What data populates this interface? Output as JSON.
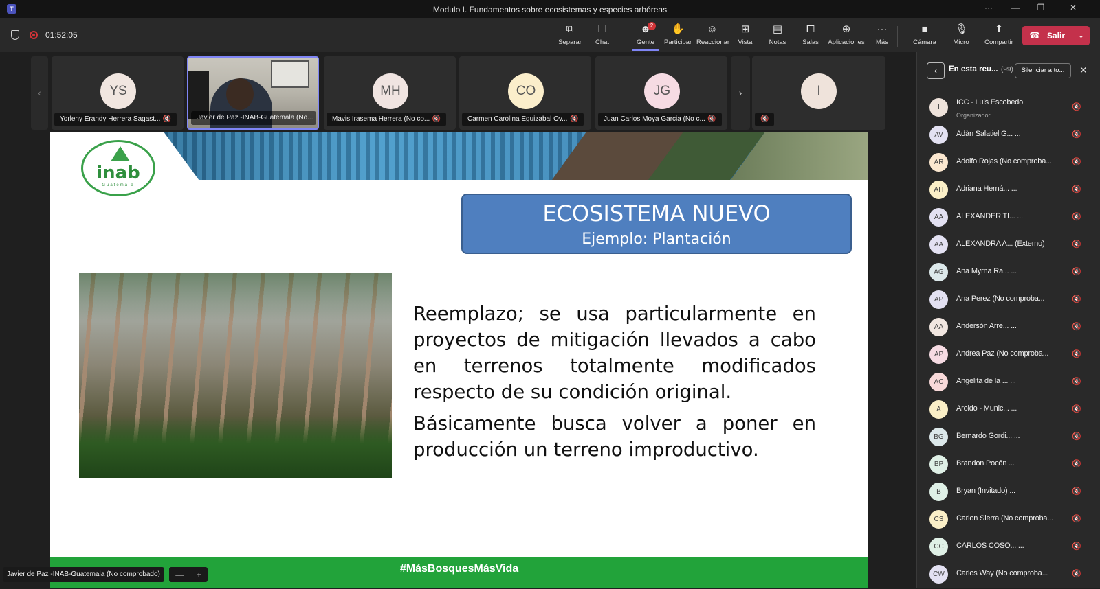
{
  "window": {
    "title": "Modulo I. Fundamentos sobre ecosistemas y especies arbóreas",
    "controls": [
      "···",
      "—",
      "❐",
      "✕"
    ]
  },
  "toolbar": {
    "timer": "01:52:05",
    "buttons": [
      {
        "label": "Separar",
        "icon": "pop-out-icon",
        "glyph": "⧉"
      },
      {
        "label": "Chat",
        "icon": "chat-icon",
        "glyph": "☐"
      },
      {
        "label": "Gente",
        "icon": "people-icon",
        "glyph": "👥",
        "badge": "2"
      },
      {
        "label": "Participar",
        "icon": "raise-hand-icon",
        "glyph": "✋"
      },
      {
        "label": "Reaccionar",
        "icon": "emoji-icon",
        "glyph": "☺"
      },
      {
        "label": "Vista",
        "icon": "grid-view-icon",
        "glyph": "⊞"
      },
      {
        "label": "Notas",
        "icon": "notes-icon",
        "glyph": "▤"
      },
      {
        "label": "Salas",
        "icon": "rooms-icon",
        "glyph": "⧠"
      },
      {
        "label": "Aplicaciones",
        "icon": "apps-icon",
        "glyph": "⊕"
      },
      {
        "label": "Más",
        "icon": "more-icon",
        "glyph": "···"
      },
      {
        "label": "Cámara",
        "icon": "camera-off-icon",
        "glyph": "■"
      },
      {
        "label": "Micro",
        "icon": "mic-off-icon",
        "glyph": "🎙"
      },
      {
        "label": "Compartir",
        "icon": "share-icon",
        "glyph": "⬆"
      }
    ],
    "leave_label": "Salir",
    "accent": "#7f85f5",
    "leave_color": "#c4314b"
  },
  "tiles": [
    {
      "initials": "YS",
      "name": "Yorleny Erandy Herrera Sagast...",
      "avatar_color": "#f1e6e0"
    },
    {
      "initials": "",
      "name": "Javier de Paz -INAB-Guatemala (No...",
      "avatar_color": "",
      "video": true
    },
    {
      "initials": "MH",
      "name": "Mavis Irasema Herrera (No co...",
      "avatar_color": "#f0e4e1"
    },
    {
      "initials": "CO",
      "name": "Carmen Carolina Eguizabal Ov...",
      "avatar_color": "#fbeecb"
    },
    {
      "initials": "JG",
      "name": "Juan Carlos Moya Garcia (No c...",
      "avatar_color": "#f6dbe3"
    },
    {
      "initials": "I",
      "name": "",
      "avatar_color": "#efe3db"
    }
  ],
  "slide": {
    "logo_text": "inab",
    "logo_sub": "Guatemala",
    "title": "ECOSISTEMA NUEVO",
    "subtitle": "Ejemplo: Plantación",
    "paragraph1": "Reemplazo; se usa particularmente en proyectos de mitigación llevados a cabo en terrenos totalmente modificados respecto de su condición original.",
    "paragraph2": "Básicamente busca volver a poner en producción un terreno improductivo.",
    "footer": "#MásBosquesMásVida"
  },
  "presenter_label": "Javier de Paz -INAB-Guatemala (No comprobado)",
  "zoom": {
    "minus": "—",
    "plus": "+"
  },
  "panel": {
    "title": "En esta reu...",
    "count": "(99)",
    "mute_all": "Silenciar a to...",
    "participants": [
      {
        "initials": "I",
        "name": "ICC - Luis Escobedo",
        "role": "Organizador",
        "color": "#efe3db"
      },
      {
        "initials": "AV",
        "name": "Adàn Salatiel G... ...",
        "role": "",
        "color": "#e3e1f2"
      },
      {
        "initials": "AR",
        "name": "Adolfo Rojas (No comproba...",
        "role": "",
        "color": "#fbe7cf"
      },
      {
        "initials": "AH",
        "name": "Adriana Herná...  ...",
        "role": "",
        "color": "#fbefc7"
      },
      {
        "initials": "AA",
        "name": "ALEXANDER TI... ...",
        "role": "",
        "color": "#e3e1f2"
      },
      {
        "initials": "AA",
        "name": "ALEXANDRA A... (Externo)",
        "role": "",
        "color": "#e3e1f2"
      },
      {
        "initials": "AG",
        "name": "Ana Myrna Ra... ...",
        "role": "",
        "color": "#dce8ea"
      },
      {
        "initials": "AP",
        "name": "Ana Perez (No comproba...",
        "role": "",
        "color": "#e3e1f2"
      },
      {
        "initials": "AA",
        "name": "Andersón Arre... ...",
        "role": "",
        "color": "#f1e6e0"
      },
      {
        "initials": "AP",
        "name": "Andrea Paz (No comproba...",
        "role": "",
        "color": "#f6dbe3"
      },
      {
        "initials": "AC",
        "name": "Angelita de la ... ...",
        "role": "",
        "color": "#f8d9d9"
      },
      {
        "initials": "A",
        "name": "Aroldo - Munic... ...",
        "role": "",
        "color": "#fbefc7"
      },
      {
        "initials": "BG",
        "name": "Bernardo Gordi... ...",
        "role": "",
        "color": "#dce8ea"
      },
      {
        "initials": "BP",
        "name": "Brandon Pocón ...",
        "role": "",
        "color": "#dff0e6"
      },
      {
        "initials": "B",
        "name": "Bryan (Invitado) ...",
        "role": "",
        "color": "#dff0e6"
      },
      {
        "initials": "CS",
        "name": "Carlon Sierra (No comproba...",
        "role": "",
        "color": "#fbefc7"
      },
      {
        "initials": "CC",
        "name": "CARLOS COSO... ...",
        "role": "",
        "color": "#dff0e6"
      },
      {
        "initials": "CW",
        "name": "Carlos Way (No comproba...",
        "role": "",
        "color": "#e3e1f2"
      }
    ]
  }
}
